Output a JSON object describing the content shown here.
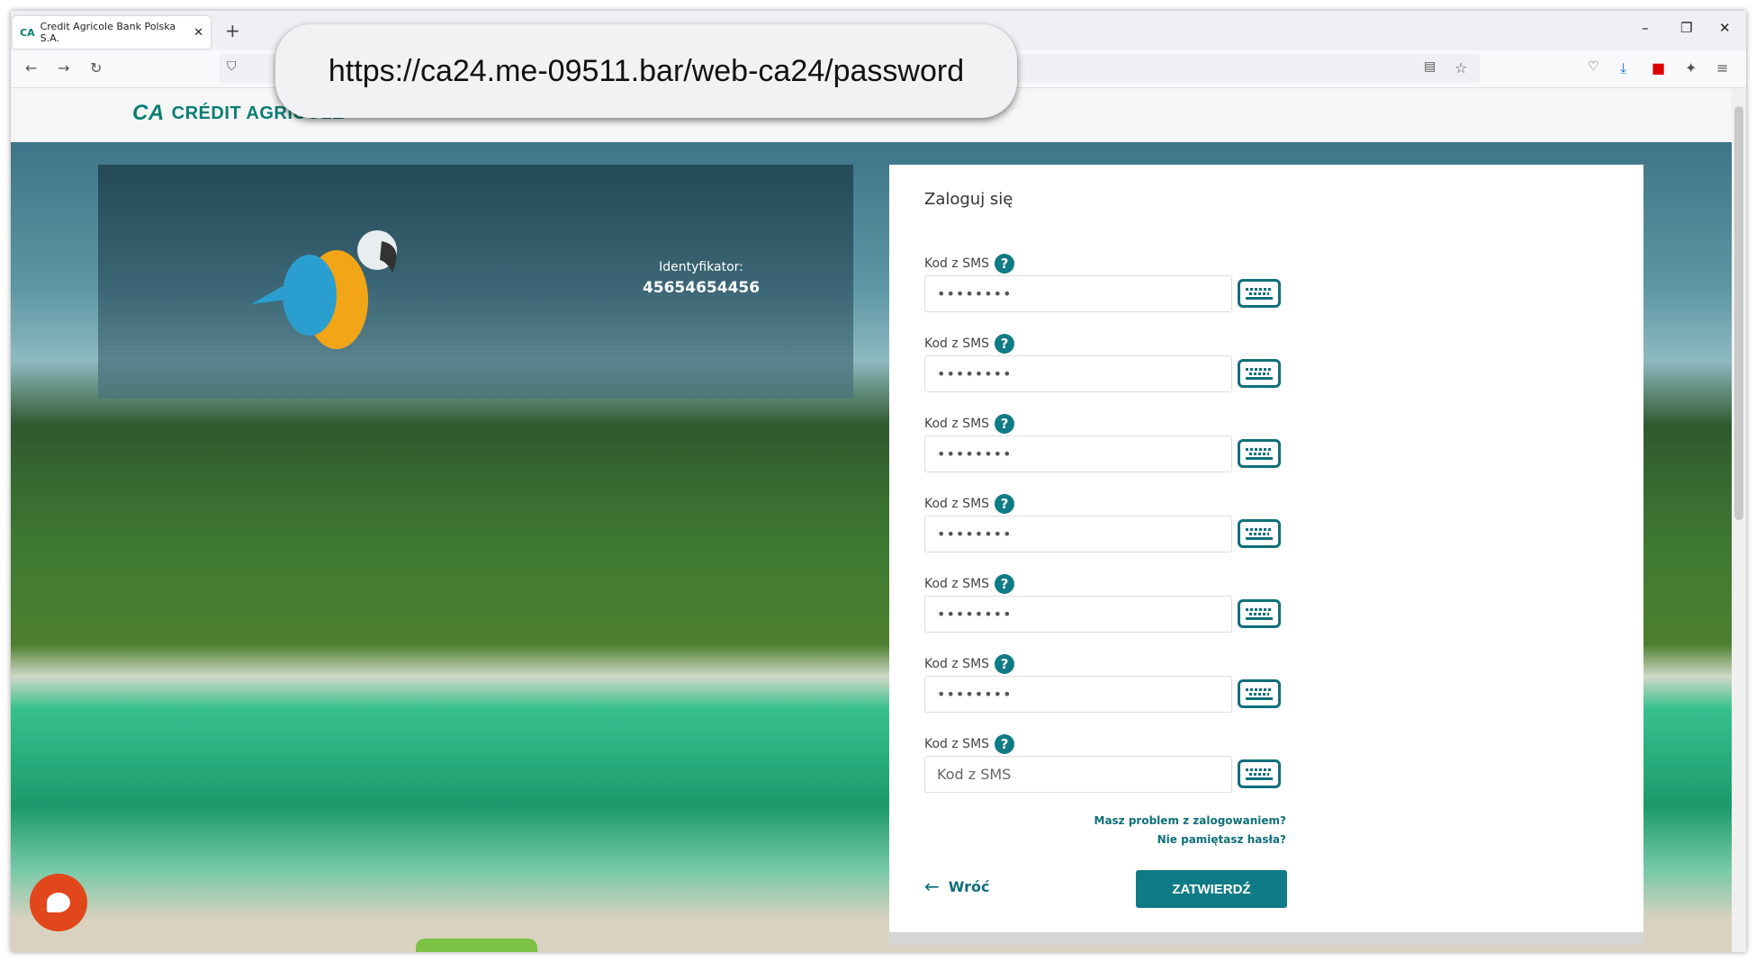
{
  "browser": {
    "tab_title": "Credit Agricole Bank Polska S.A.",
    "url": "https://ca24.me-09511.bar/web-ca24/password"
  },
  "header": {
    "logo_text": "CRÉDIT AGRICOLE"
  },
  "identity": {
    "label": "Identyfikator:",
    "value": "45654654456"
  },
  "form": {
    "title": "Zaloguj się",
    "fields": [
      {
        "label": "Kod z SMS",
        "value": "••••••••"
      },
      {
        "label": "Kod z SMS",
        "value": "••••••••"
      },
      {
        "label": "Kod z SMS",
        "value": "••••••••"
      },
      {
        "label": "Kod z SMS",
        "value": "••••••••"
      },
      {
        "label": "Kod z SMS",
        "value": "••••••••"
      },
      {
        "label": "Kod z SMS",
        "value": "••••••••"
      },
      {
        "label": "Kod z SMS",
        "value": "",
        "placeholder": "Kod z SMS"
      }
    ],
    "help_icon": "?",
    "link_problem": "Masz problem z zalogowaniem?",
    "link_forgot": "Nie pamiętasz hasła?",
    "back_label": "Wróć",
    "submit_label": "ZATWIERDŹ"
  },
  "colors": {
    "accent": "#0f7b86",
    "chat": "#e2461b"
  }
}
